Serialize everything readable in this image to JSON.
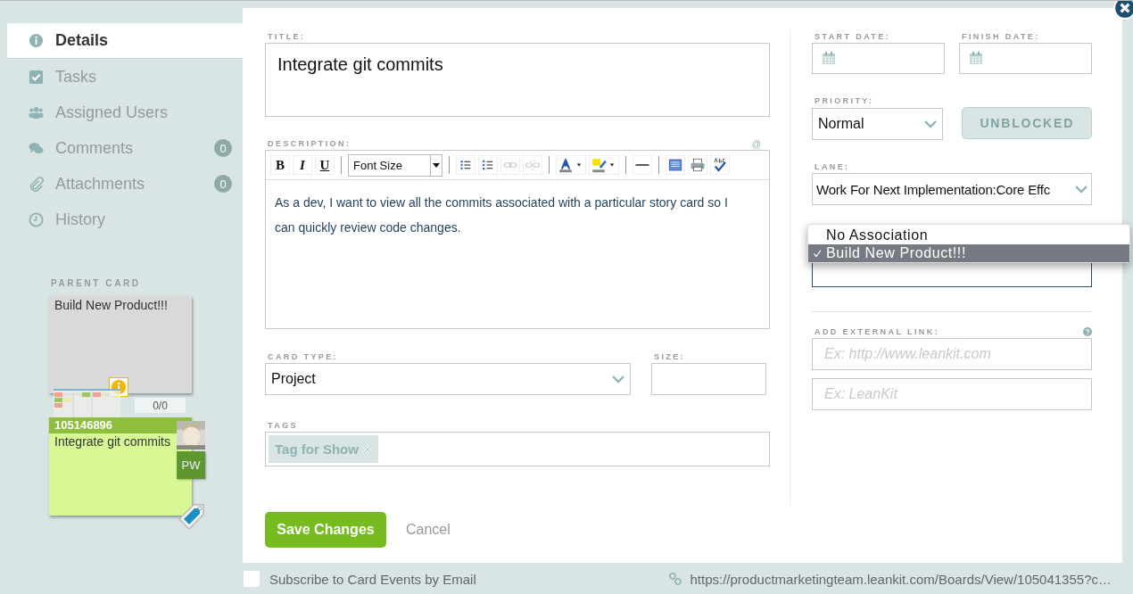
{
  "sidebar": {
    "items": [
      {
        "label": "Details",
        "selected": true
      },
      {
        "label": "Tasks",
        "selected": false
      },
      {
        "label": "Assigned Users",
        "selected": false
      },
      {
        "label": "Comments",
        "selected": false,
        "count": "0"
      },
      {
        "label": "Attachments",
        "selected": false,
        "count": "0"
      },
      {
        "label": "History",
        "selected": false
      }
    ],
    "parent_card": {
      "heading": "PARENT CARD",
      "title": "Build New Product!!!",
      "progress": "0/0"
    },
    "card": {
      "id": "105146896",
      "title": "Integrate git commits",
      "initials": "PW"
    }
  },
  "form": {
    "title_label": "TITLE:",
    "title": "Integrate git commits",
    "description_label": "DESCRIPTION:",
    "mention_hint": "@",
    "toolbar": {
      "format_buttons": [
        "B",
        "I",
        "U"
      ],
      "font_size": "Font Size"
    },
    "description": "As a dev, I want to view all the commits associated with a particular story card so I can quickly review code changes.",
    "card_type_label": "CARD TYPE:",
    "card_type": "Project",
    "size_label": "SIZE:",
    "tags_label": "TAGS",
    "tags": [
      {
        "label": "Tag for Show"
      }
    ],
    "save": "Save Changes",
    "cancel": "Cancel"
  },
  "details": {
    "start_date_label": "START DATE:",
    "finish_date_label": "FINISH DATE:",
    "priority_label": "PRIORITY:",
    "priority": "Normal",
    "block_button": "UNBLOCKED",
    "lane_label": "LANE:",
    "lane": "Work For Next Implementation:Core Effc",
    "association_menu": [
      {
        "label": "No Association",
        "selected": false
      },
      {
        "label": "Build New Product!!!",
        "selected": true
      }
    ],
    "external_link_label": "ADD EXTERNAL LINK:",
    "url_placeholder": "Ex: http://www.leankit.com",
    "name_placeholder": "Ex: LeanKit"
  },
  "footer": {
    "subscribe_label": "Subscribe to Card Events by Email",
    "subscribed": false,
    "url": "https://productmarketingteam.leankit.com/Boards/View/105041355?c…"
  }
}
